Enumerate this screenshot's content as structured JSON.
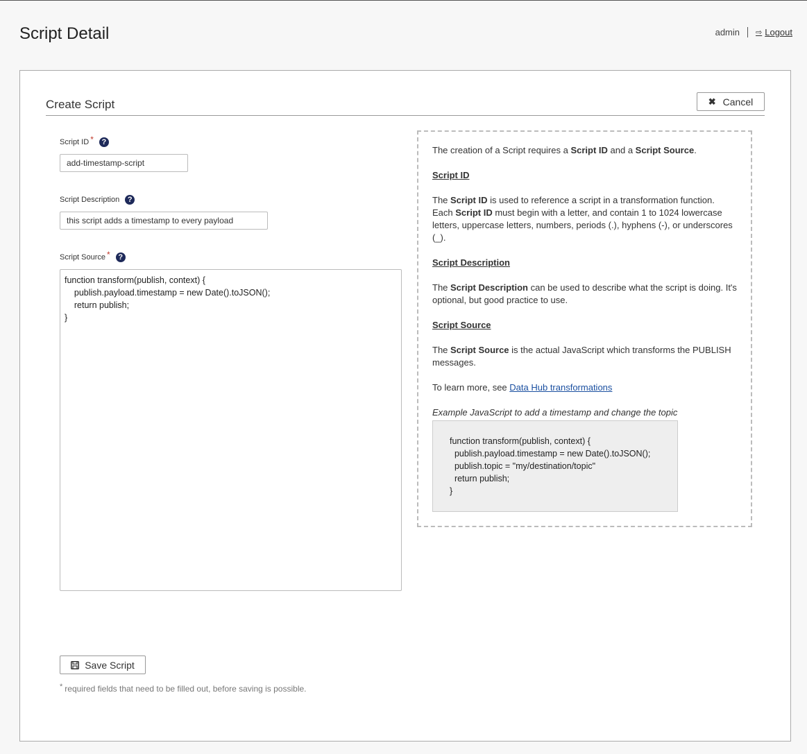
{
  "header": {
    "title": "Script Detail",
    "user": "admin",
    "logout_label": "Logout"
  },
  "panel": {
    "title": "Create Script",
    "cancel_label": "Cancel"
  },
  "form": {
    "script_id": {
      "label": "Script ID",
      "value": "add-timestamp-script"
    },
    "description": {
      "label": "Script Description",
      "value": "this script adds a timestamp to every payload"
    },
    "source": {
      "label": "Script Source",
      "value": "function transform(publish, context) {\n    publish.payload.timestamp = new Date().toJSON();\n    return publish;\n}"
    },
    "required_mark": "*",
    "help_glyph": "?"
  },
  "help": {
    "intro_pre": "The creation of a Script requires a ",
    "intro_b1": "Script ID",
    "intro_mid": " and a ",
    "intro_b2": "Script Source",
    "intro_post": ".",
    "id_heading": "Script ID",
    "id_pre": "The ",
    "id_b1": "Script ID",
    "id_mid1": " is used to reference a script in a transformation function. Each ",
    "id_b2": "Script ID",
    "id_post": " must begin with a letter, and contain 1 to 1024 lowercase letters, uppercase letters, numbers, periods (.), hyphens (-), or underscores (_).",
    "desc_heading": "Script Description",
    "desc_pre": "The ",
    "desc_b": "Script Description",
    "desc_post": " can be used to describe what the script is doing. It's optional, but good practice to use.",
    "src_heading": "Script Source",
    "src_pre": "The ",
    "src_b": "Script Source",
    "src_post": " is the actual JavaScript which transforms the PUBLISH messages.",
    "learn_pre": "To learn more, see ",
    "learn_link": "Data Hub transformations",
    "example_caption": "Example JavaScript to add a timestamp and change the topic",
    "example_code": "function transform(publish, context) {\n  publish.payload.timestamp = new Date().toJSON();\n  publish.topic = \"my/destination/topic\"\n  return publish;\n}"
  },
  "footer": {
    "save_label": "Save Script",
    "footnote_star": "*",
    "footnote": "required fields that need to be filled out, before saving is possible."
  }
}
